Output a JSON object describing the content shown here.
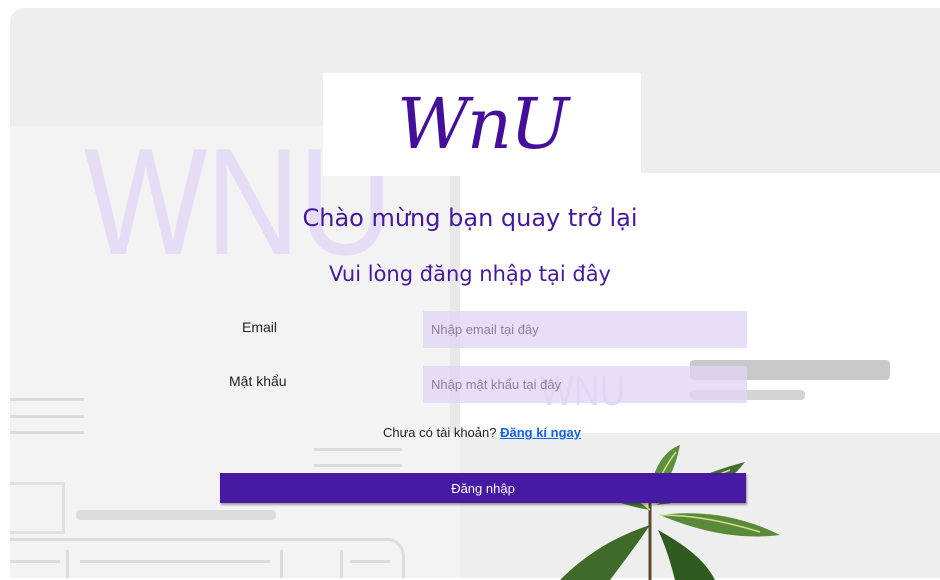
{
  "background": {
    "watermark_large": "WNU",
    "watermark_small": "WNU"
  },
  "logo": {
    "text": "WnU"
  },
  "heading": {
    "title": "Chào mừng bạn quay trở lại",
    "subtitle": "Vui lòng đăng nhập tại đây"
  },
  "form": {
    "email_label": "Email",
    "email_placeholder": "Nhập email tại đây",
    "email_value": "",
    "password_label": "Mật khẩu",
    "password_placeholder": "Nhập mật khẩu tại đây",
    "password_value": "",
    "signup_prompt": "Chưa có tài khoản?",
    "signup_link": "Đăng kí ngay",
    "submit_label": "Đăng nhập"
  },
  "colors": {
    "brand_purple": "#45189c",
    "button_purple": "#461aa3",
    "link_blue": "#1263e6",
    "input_lavender": "#e0d6f6"
  }
}
